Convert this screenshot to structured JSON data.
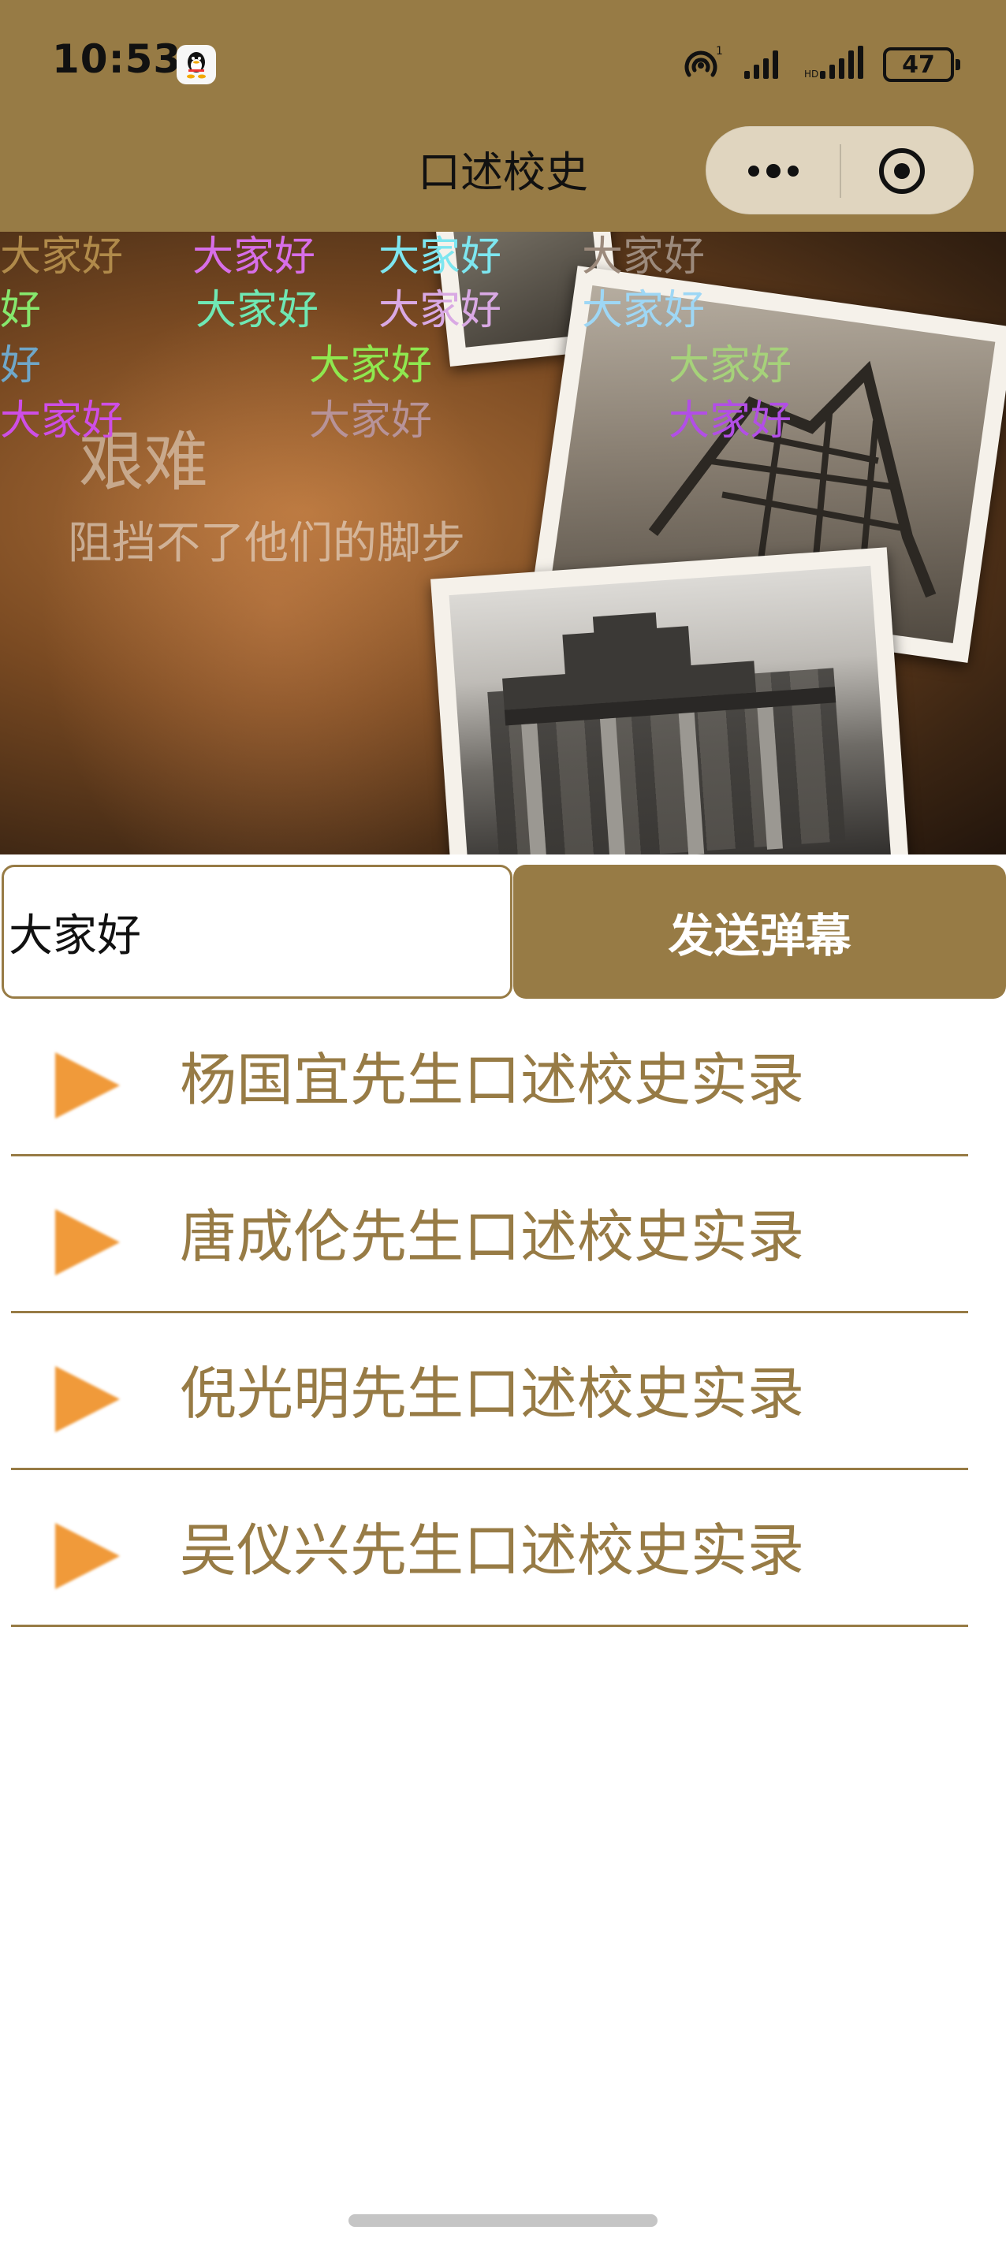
{
  "status_bar": {
    "time": "10:53",
    "battery": "47",
    "icons": [
      "qq-icon",
      "hotspot-icon",
      "signal-icon",
      "signal-icon",
      "battery-icon"
    ]
  },
  "nav": {
    "title": "口述校史",
    "capsule_icons": [
      "more-dots-icon",
      "close-target-icon"
    ]
  },
  "video": {
    "overlay_title": "艰难",
    "overlay_subtitle": "阻挡不了他们的脚步",
    "danmaku": [
      {
        "text": "大家好",
        "color": "#b08a4a"
      },
      {
        "text": "大家好",
        "color": "#d76ee8"
      },
      {
        "text": "大家好",
        "color": "#7de6f0"
      },
      {
        "text": "大家好",
        "color": "#9c8a7c"
      },
      {
        "text": "好",
        "color": "#86e86d"
      },
      {
        "text": "大家好",
        "color": "#6fe8b4"
      },
      {
        "text": "大家好",
        "color": "#d9a9e4"
      },
      {
        "text": "大家好",
        "color": "#9ed7f5"
      },
      {
        "text": "好",
        "color": "#6fa7c9"
      },
      {
        "text": "大家好",
        "color": "#8fe84f"
      },
      {
        "text": "大家好",
        "color": "#a6d27a"
      },
      {
        "text": "大家好",
        "color": "#ce4ee6"
      },
      {
        "text": "大家好",
        "color": "#b79399"
      },
      {
        "text": "大家好",
        "color": "#b24ee6"
      }
    ]
  },
  "danmu_form": {
    "input_value": "大家好",
    "send_label": "发送弹幕"
  },
  "records": [
    {
      "title": "杨国宜先生口述校史实录",
      "icon": "play-icon"
    },
    {
      "title": "唐成伦先生口述校史实录",
      "icon": "play-icon"
    },
    {
      "title": "倪光明先生口述校史实录",
      "icon": "play-icon"
    },
    {
      "title": "吴仪兴先生口述校史实录",
      "icon": "play-icon"
    }
  ],
  "colors": {
    "brand": "#977b45",
    "capsule": "#e0d5bf",
    "play_icon": "#f09a3a",
    "background": "#ffffff"
  }
}
